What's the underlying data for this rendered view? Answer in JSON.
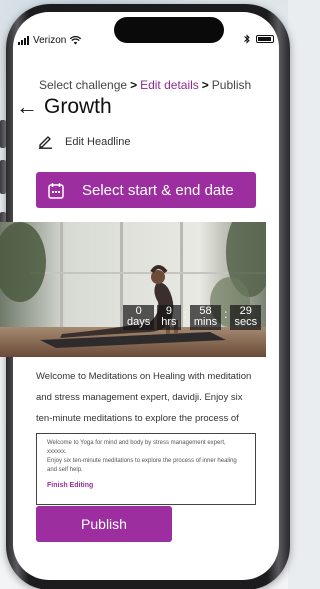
{
  "status_bar": {
    "carrier": "Verizon",
    "wifi_icon": "wifi-icon",
    "bluetooth_icon": "bluetooth-icon",
    "battery_icon": "battery-icon"
  },
  "breadcrumb": {
    "step1": "Select challenge",
    "step2": "Edit details",
    "step3": "Publish"
  },
  "header": {
    "title": "Growth",
    "back_icon": "arrow-left-icon"
  },
  "edit_headline": {
    "label": "Edit Headline",
    "icon": "pencil-icon"
  },
  "date_button": {
    "label": "Select start & end date",
    "icon": "calendar-icon"
  },
  "countdown": {
    "days": "0",
    "days_unit": "days",
    "hrs": "9",
    "hrs_unit": "hrs",
    "mins": "58",
    "mins_unit": "mins",
    "secs": "29",
    "secs_unit": "secs"
  },
  "description": "Welcome to Meditations on Healing with meditation and stress management expert, davidji. Enjoy six ten-minute meditations to explore the process of",
  "editor": {
    "text1": "Welcome to Yoga for mind and body by stress management expert, xxxxxx.",
    "text2": "Enjoy six ten-minute meditations to explore the process of inner healing and self help.",
    "finish_label": "Finish Editing"
  },
  "publish_button": {
    "label": "Publish"
  },
  "colors": {
    "accent": "#9c2e9f",
    "text": "#111111"
  }
}
